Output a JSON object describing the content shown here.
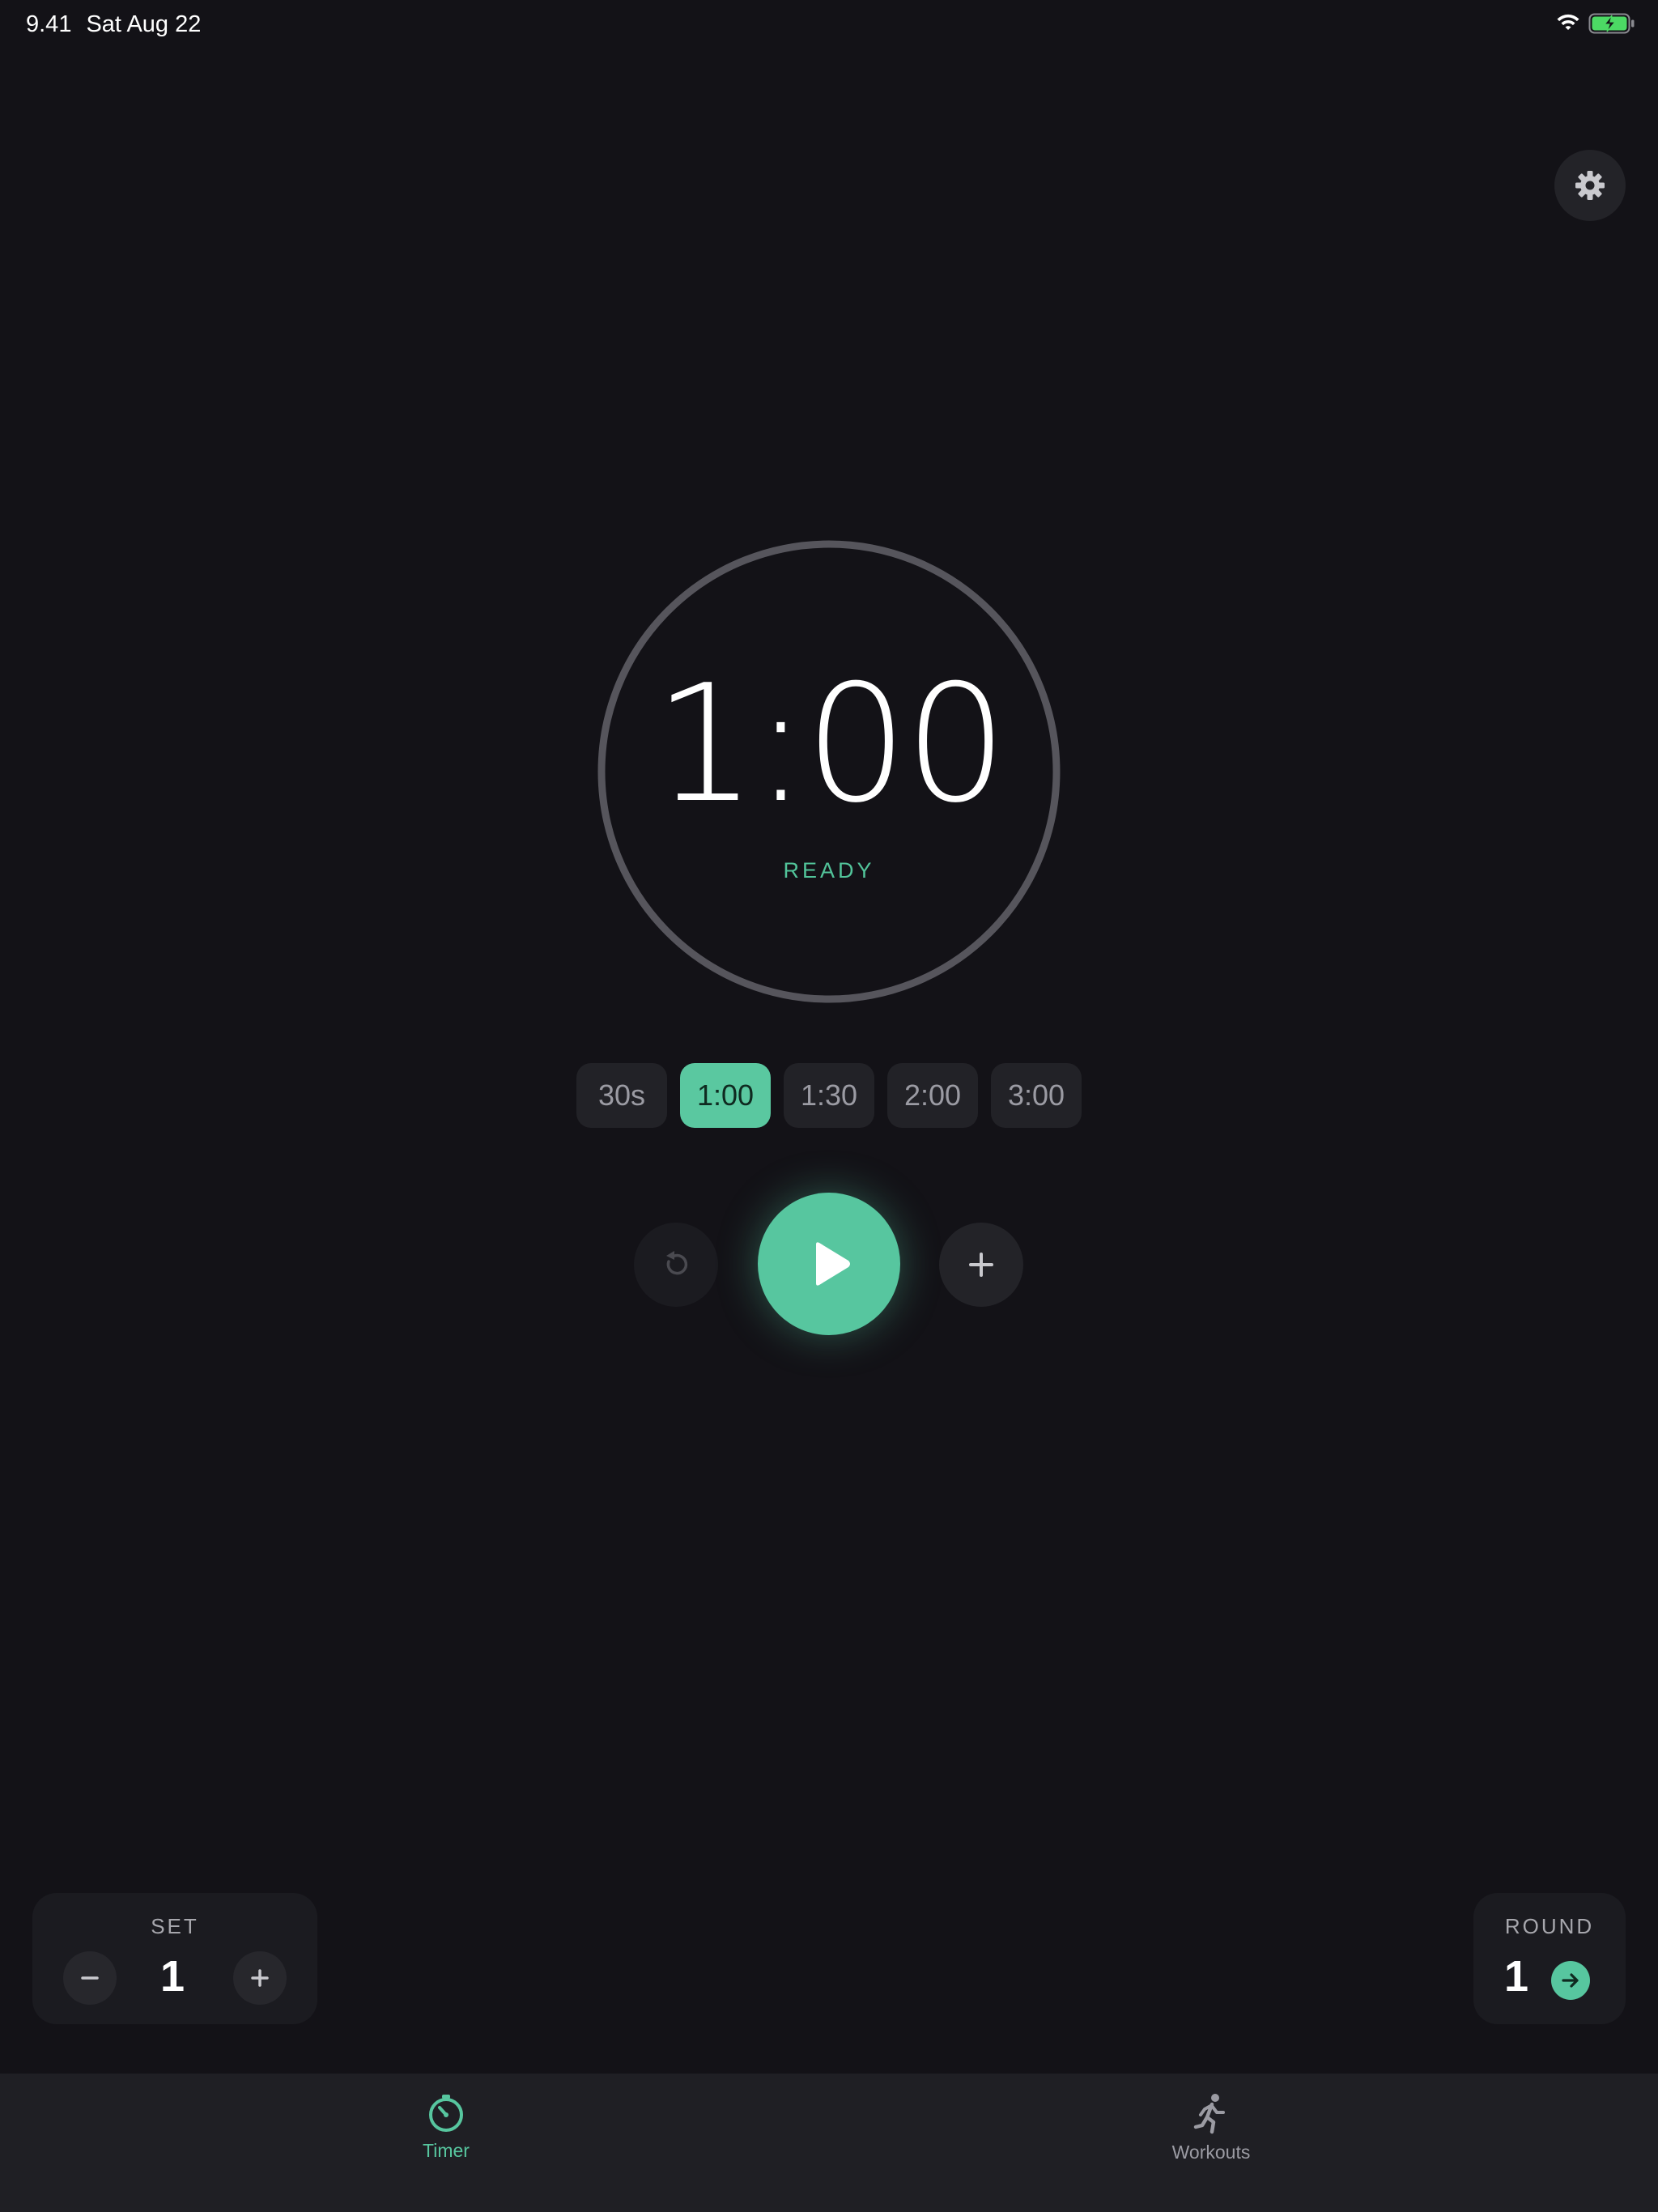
{
  "status_bar": {
    "time": "9.41",
    "date": "Sat Aug 22"
  },
  "timer": {
    "display": "1:00",
    "state": "READY",
    "progress": 0
  },
  "presets": [
    {
      "label": "30s",
      "active": false
    },
    {
      "label": "1:00",
      "active": true
    },
    {
      "label": "1:30",
      "active": false
    },
    {
      "label": "2:00",
      "active": false
    },
    {
      "label": "3:00",
      "active": false
    }
  ],
  "controls": {
    "reset_icon": "reset-icon",
    "play_icon": "play-icon",
    "add_icon": "plus-icon"
  },
  "set_card": {
    "label": "SET",
    "value": "1"
  },
  "round_card": {
    "label": "ROUND",
    "value": "1"
  },
  "tabs": [
    {
      "label": "Timer",
      "icon": "stopwatch-icon",
      "active": true
    },
    {
      "label": "Workouts",
      "icon": "running-figure-icon",
      "active": false
    }
  ],
  "colors": {
    "background": "#131217",
    "accent": "#57c69f",
    "ring": "#56555c",
    "surface": "#222227"
  }
}
